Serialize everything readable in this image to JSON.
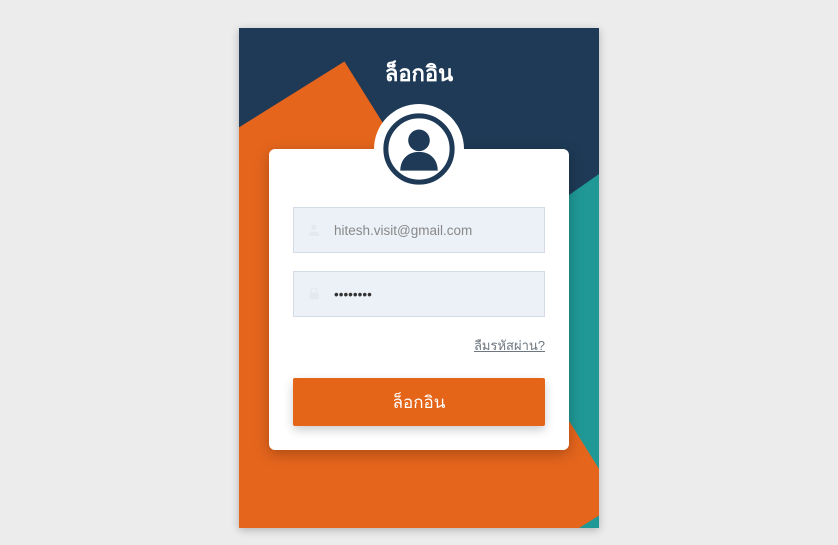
{
  "panel": {
    "title": "ล็อกอิน"
  },
  "form": {
    "email": {
      "placeholder": "hitesh.visit@gmail.com",
      "value": ""
    },
    "password": {
      "placeholder": "",
      "value": "••••••••"
    },
    "forgot_label": "ลืมรหัสผ่าน?",
    "submit_label": "ล็อกอิน"
  },
  "colors": {
    "navy": "#1e3a56",
    "teal": "#1f9896",
    "orange": "#e5651d",
    "input_bg": "#ecf1f8"
  }
}
